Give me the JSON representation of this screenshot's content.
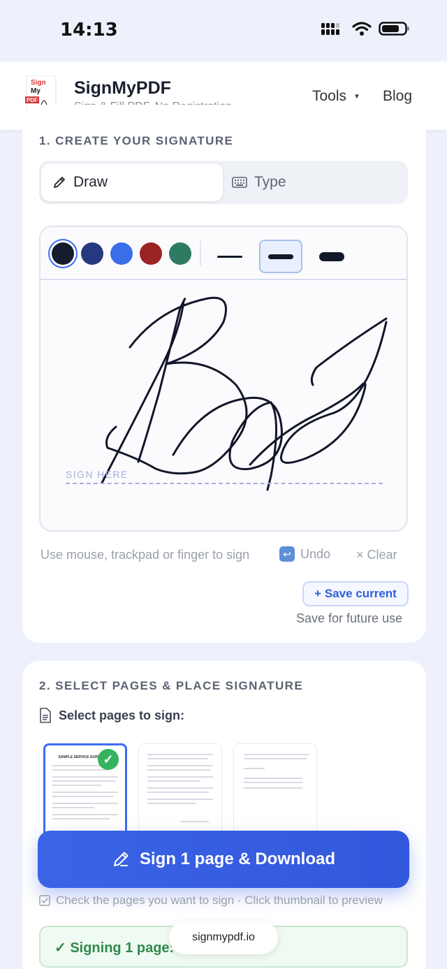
{
  "status": {
    "time": "14:13"
  },
  "header": {
    "logo_text": [
      "Sign",
      "My",
      "PDF"
    ],
    "title": "SignMyPDF",
    "subtitle": "Sign & Fill PDF, No Registration",
    "nav": {
      "tools": "Tools",
      "blog": "Blog"
    }
  },
  "create": {
    "section_title": "1. CREATE YOUR SIGNATURE",
    "tabs": {
      "draw": "Draw",
      "type": "Type"
    },
    "selected_tab": "Draw",
    "colors": [
      "#161b2e",
      "#24397f",
      "#3a6ee8",
      "#9a2424",
      "#2f7a62"
    ],
    "selected_color_index": 0,
    "stroke_widths": [
      "thin",
      "medium",
      "thick"
    ],
    "selected_stroke": "medium",
    "sign_here": "SIGN HERE",
    "hint": "Use mouse, trackpad or finger to sign",
    "undo": "Undo",
    "clear": "× Clear",
    "save_current": "+ Save current",
    "save_note": "Save for future use"
  },
  "place": {
    "section_title": "2. SELECT PAGES & PLACE SIGNATURE",
    "select_label": "Select pages to sign:",
    "thumb1_title": "SAMPLE SERVICE AGREEMENT",
    "selected_pages": [
      1
    ],
    "sign_button": "Sign 1 page & Download",
    "check_note": "Check the pages you want to sign · Click thumbnail to preview",
    "signing_status": "✓ Signing 1 page:"
  },
  "browser": {
    "url": "signmypdf.io"
  }
}
